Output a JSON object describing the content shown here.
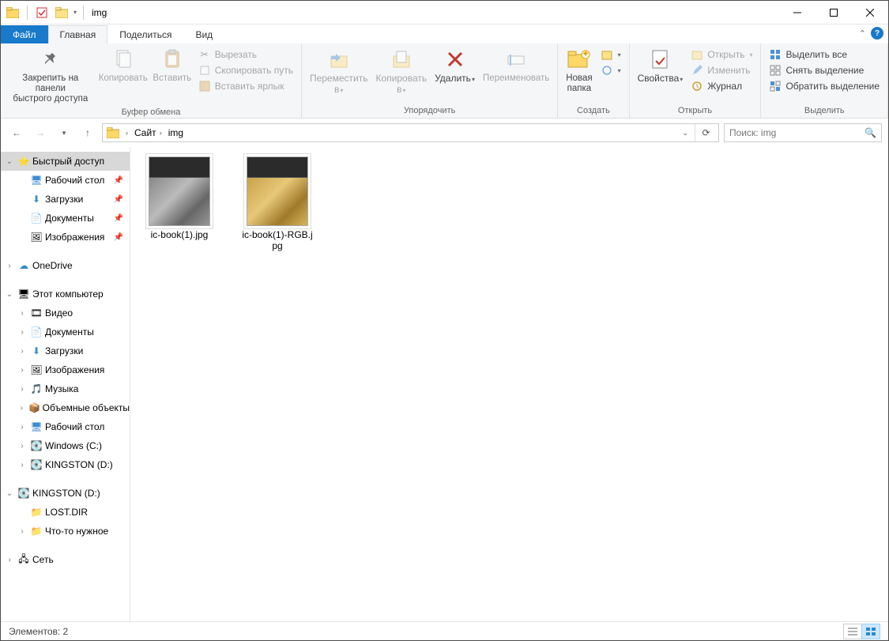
{
  "window": {
    "title": "img"
  },
  "tabs": {
    "file": "Файл",
    "home": "Главная",
    "share": "Поделиться",
    "view": "Вид"
  },
  "ribbon": {
    "clipboard": {
      "label": "Буфер обмена",
      "pin": "Закрепить на панели\nбыстрого доступа",
      "copy": "Копировать",
      "paste": "Вставить",
      "cut": "Вырезать",
      "copypath": "Скопировать путь",
      "pastelnk": "Вставить ярлык"
    },
    "organize": {
      "label": "Упорядочить",
      "moveto": "Переместить\nв",
      "copyto": "Копировать\nв",
      "delete": "Удалить",
      "rename": "Переименовать"
    },
    "new": {
      "label": "Создать",
      "newfolder": "Новая\nпапка"
    },
    "open": {
      "label": "Открыть",
      "properties": "Свойства",
      "open": "Открыть",
      "edit": "Изменить",
      "history": "Журнал"
    },
    "select": {
      "label": "Выделить",
      "all": "Выделить все",
      "none": "Снять выделение",
      "invert": "Обратить выделение"
    }
  },
  "breadcrumb": {
    "root": "Сайт",
    "current": "img"
  },
  "search": {
    "placeholder": "Поиск: img"
  },
  "tree": {
    "quick": "Быстрый доступ",
    "desktop": "Рабочий стол",
    "downloads": "Загрузки",
    "documents": "Документы",
    "pictures": "Изображения",
    "onedrive": "OneDrive",
    "thispc": "Этот компьютер",
    "video": "Видео",
    "documents2": "Документы",
    "downloads2": "Загрузки",
    "pictures2": "Изображения",
    "music": "Музыка",
    "objects3d": "Объемные объекты",
    "desktop2": "Рабочий стол",
    "cdrive": "Windows (C:)",
    "ddrive": "KINGSTON (D:)",
    "ddrive2": "KINGSTON (D:)",
    "lostdir": "LOST.DIR",
    "something": "Что-то нужное",
    "network": "Сеть"
  },
  "files": [
    {
      "name": "ic-book(1).jpg",
      "variant": "bw"
    },
    {
      "name": "ic-book(1)-RGB.jpg",
      "variant": "rgb"
    }
  ],
  "status": {
    "count_label": "Элементов:",
    "count": "2"
  }
}
